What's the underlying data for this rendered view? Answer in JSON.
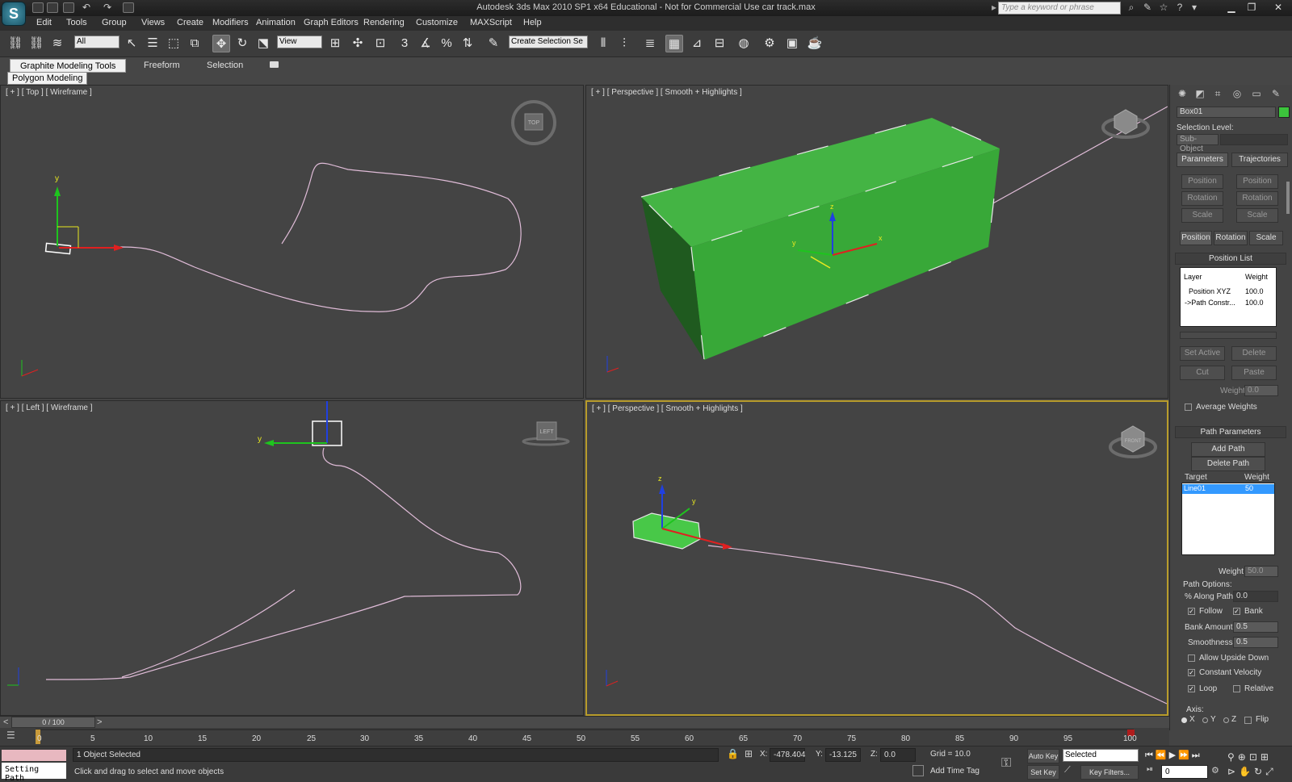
{
  "window": {
    "title": "Autodesk 3ds Max  2010 SP1 x64    Educational - Not for Commercial Use       car track.max",
    "search_placeholder": "Type a keyword or phrase",
    "logo_glyph": "S"
  },
  "menu": [
    "Edit",
    "Tools",
    "Group",
    "Views",
    "Create",
    "Modifiers",
    "Animation",
    "Graph Editors",
    "Rendering",
    "Customize",
    "MAXScript",
    "Help"
  ],
  "toolbar": {
    "selection_filter": "All",
    "ref_coord": "View",
    "named_selection": "Create Selection Se",
    "snap_label": "3"
  },
  "ribbon": {
    "tabs": [
      "Graphite Modeling Tools",
      "Freeform",
      "Selection"
    ],
    "panel": "Polygon Modeling"
  },
  "viewports": {
    "top": {
      "label": "[ + ] [ Top ] [ Wireframe ]",
      "cube": "TOP"
    },
    "persp1": {
      "label": "[ + ] [ Perspective ] [ Smooth + Highlights ]"
    },
    "left": {
      "label": "[ + ] [ Left ] [ Wireframe ]",
      "cube": "LEFT"
    },
    "persp2": {
      "label": "[ + ] [ Perspective ] [ Smooth + Highlights ]",
      "cube": "FRONT"
    }
  },
  "axes": {
    "x": "x",
    "y": "y",
    "z": "z"
  },
  "command_panel": {
    "object_name": "Box01",
    "object_color": "#3cc43c",
    "selection_level_label": "Selection Level:",
    "sub_object": "Sub-Object",
    "tabs": [
      "Parameters",
      "Trajectories"
    ],
    "prs_left": [
      "Position",
      "Rotation",
      "Scale"
    ],
    "prs_right": [
      "Position",
      "Rotation",
      "Scale"
    ],
    "prs_row": [
      "Position",
      "Rotation",
      "Scale"
    ],
    "position_list": {
      "title": "Position List",
      "col_layer": "Layer",
      "col_weight": "Weight",
      "rows": [
        {
          "layer": "Position XYZ",
          "weight": "100.0"
        },
        {
          "layer": "->Path Constr...",
          "weight": "100.0"
        }
      ],
      "set_active": "Set Active",
      "delete": "Delete",
      "cut": "Cut",
      "paste": "Paste",
      "weight_label": "Weight:",
      "weight_value": "0.0",
      "average_weights": "Average Weights"
    },
    "path_params": {
      "title": "Path Parameters",
      "add_path": "Add Path",
      "delete_path": "Delete Path",
      "col_target": "Target",
      "col_weight": "Weight",
      "rows": [
        {
          "target": "Line01",
          "weight": "50"
        }
      ],
      "weight_label": "Weight",
      "weight_value": "50.0",
      "path_options": "Path Options:",
      "along_path_label": "% Along Path:",
      "along_path_value": "0.0",
      "follow": "Follow",
      "bank": "Bank",
      "bank_amount_label": "Bank Amount:",
      "bank_amount_value": "0.5",
      "smoothness_label": "Smoothness:",
      "smoothness_value": "0.5",
      "allow_upside_down": "Allow Upside Down",
      "constant_velocity": "Constant Velocity",
      "loop": "Loop",
      "relative": "Relative",
      "axis_label": "Axis:",
      "axis_x": "X",
      "axis_y": "Y",
      "axis_z": "Z",
      "flip": "Flip"
    }
  },
  "timeline": {
    "frame": "0 / 100",
    "ticks": [
      "0",
      "5",
      "10",
      "15",
      "20",
      "25",
      "30",
      "35",
      "40",
      "45",
      "50",
      "55",
      "60",
      "65",
      "70",
      "75",
      "80",
      "85",
      "90",
      "95",
      "100"
    ],
    "prev": "<",
    "next": ">"
  },
  "status": {
    "script_label": "Setting Path",
    "selected": "1 Object Selected",
    "prompt": "Click and drag to select and move objects",
    "x_label": "X:",
    "x_value": "-478.404",
    "y_label": "Y:",
    "y_value": "-13.125",
    "z_label": "Z:",
    "z_value": "0.0",
    "grid": "Grid = 10.0",
    "add_time_tag": "Add Time Tag",
    "auto_key": "Auto Key",
    "set_key": "Set Key",
    "selected_dd": "Selected",
    "key_filters": "Key Filters...",
    "frame_value": "0"
  }
}
